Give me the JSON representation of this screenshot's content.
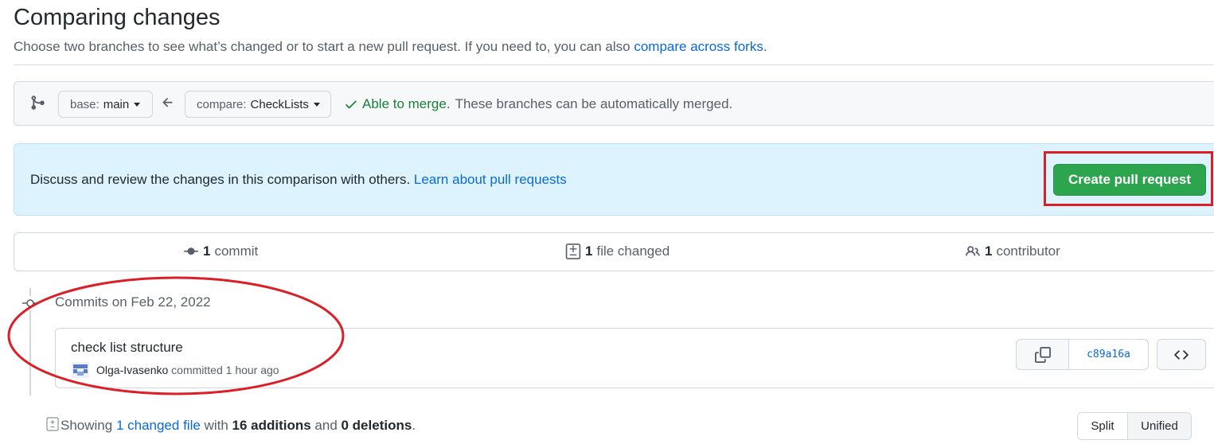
{
  "header": {
    "title": "Comparing changes",
    "subtitle_text": "Choose two branches to see what’s changed or to start a new pull request. If you need to, you can also ",
    "subtitle_link": "compare across forks",
    "subtitle_end": "."
  },
  "range": {
    "base_prefix": "base:",
    "base_branch": "main",
    "compare_prefix": "compare:",
    "compare_branch": "CheckLists",
    "merge_status_strong": "Able to merge.",
    "merge_status_text": "These branches can be automatically merged."
  },
  "flash": {
    "text": "Discuss and review the changes in this comparison with others. ",
    "link": "Learn about pull requests",
    "create_button": "Create pull request"
  },
  "summary": {
    "commits_count": "1",
    "commits_label": "commit",
    "files_count": "1",
    "files_label": "file changed",
    "contributors_count": "1",
    "contributors_label": "contributor"
  },
  "timeline": {
    "date_header": "Commits on Feb 22, 2022",
    "commit": {
      "message": "check list structure",
      "author": "Olga-Ivasenko",
      "action": "committed",
      "time": "1 hour ago",
      "sha": "c89a16a"
    }
  },
  "files": {
    "showing": "Showing ",
    "changed_link": "1 changed file",
    "with": " with ",
    "additions": "16 additions",
    "and": " and ",
    "deletions": "0 deletions",
    "end": ".",
    "split_label": "Split",
    "unified_label": "Unified"
  },
  "colors": {
    "accent": "#0969da",
    "success": "#1a7f37",
    "primary_button": "#2da44e",
    "annotation_red": "#dc1f26",
    "flash_bg": "#ddf4ff"
  }
}
